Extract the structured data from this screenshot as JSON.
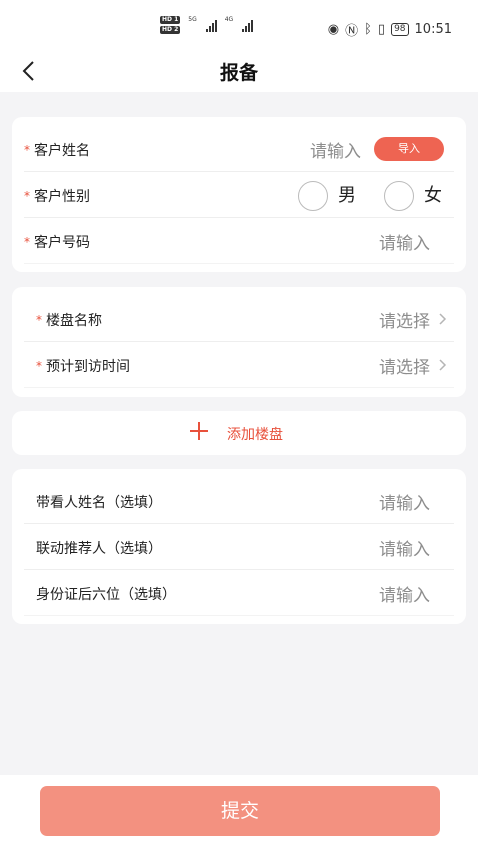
{
  "status_bar": {
    "hd1": "HD 1",
    "hd2": "HD 2",
    "net1": "5G",
    "net2": "4G",
    "battery": "98",
    "time": "10:51"
  },
  "header": {
    "title": "报备"
  },
  "customer": {
    "name_label": "客户姓名",
    "name_placeholder": "请输入",
    "import_label": "导入",
    "gender_label": "客户性别",
    "gender_male": "男",
    "gender_female": "女",
    "phone_label": "客户号码",
    "phone_placeholder": "请输入"
  },
  "property": {
    "name_label": "楼盘名称",
    "name_placeholder": "请选择",
    "visit_label": "预计到访时间",
    "visit_placeholder": "请选择"
  },
  "add_property": {
    "label": "添加楼盘"
  },
  "optional": {
    "guide_label": "带看人姓名（选填）",
    "guide_placeholder": "请输入",
    "referrer_label": "联动推荐人（选填）",
    "referrer_placeholder": "请输入",
    "id_label": "身份证后六位（选填）",
    "id_placeholder": "请输入"
  },
  "footer": {
    "submit_label": "提交"
  },
  "required_mark": "*",
  "colors": {
    "accent": "#e8513c",
    "button": "#f39180",
    "background": "#f4f4f6"
  }
}
